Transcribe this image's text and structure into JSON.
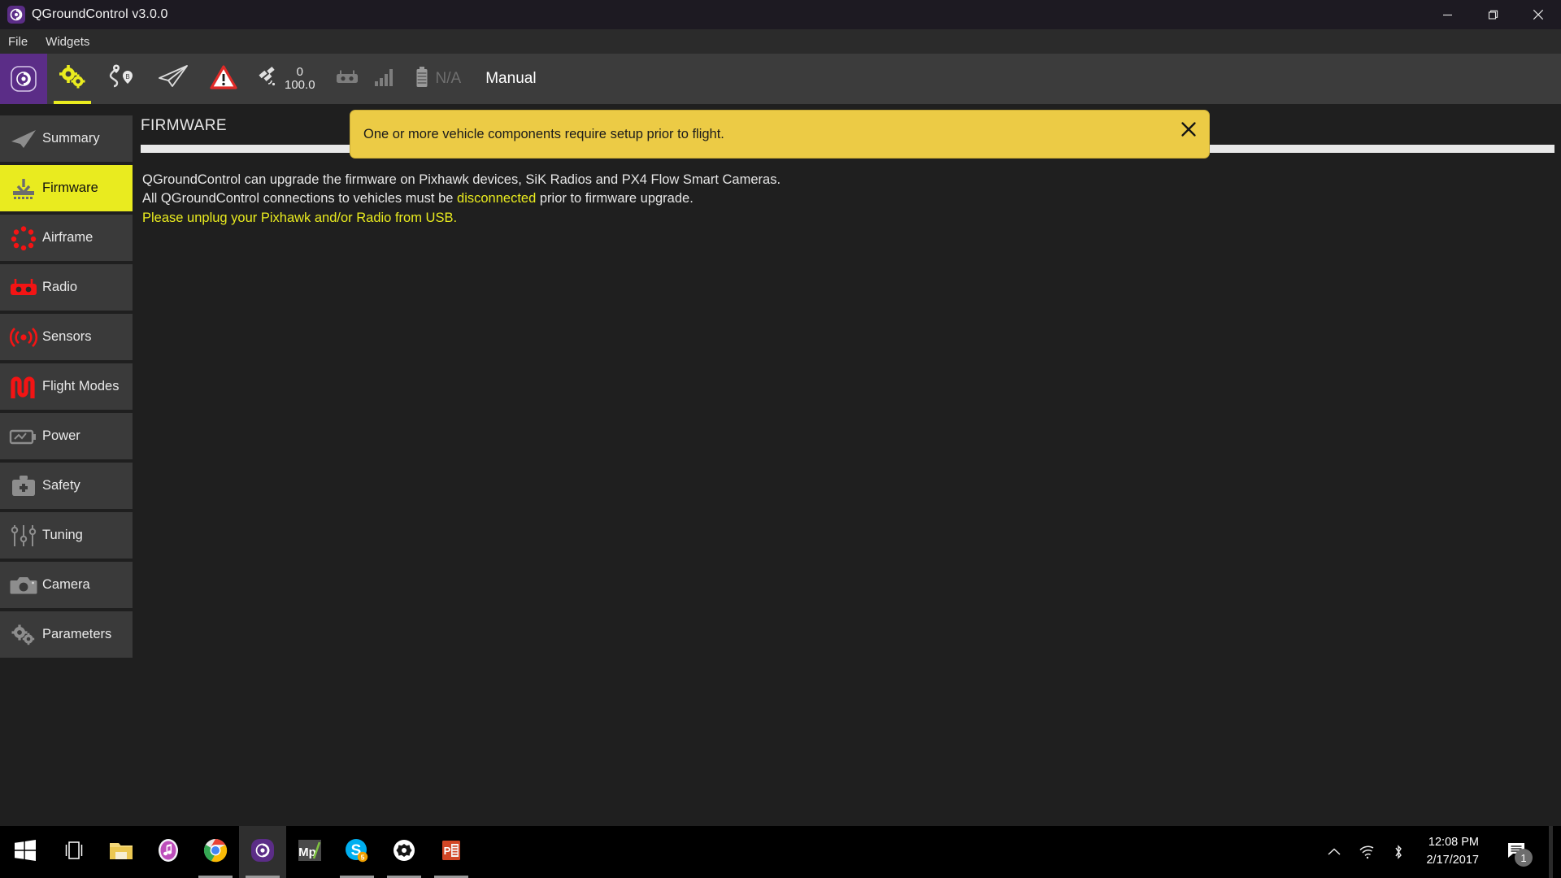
{
  "window": {
    "title": "QGroundControl v3.0.0",
    "app_icon": "qgroundcontrol-logo-icon",
    "minimize_label": "Minimize",
    "restore_label": "Restore",
    "close_label": "Close"
  },
  "menubar": {
    "items": [
      {
        "label": "File",
        "name": "menu-file"
      },
      {
        "label": "Widgets",
        "name": "menu-widgets"
      }
    ]
  },
  "toolbar": {
    "logo_icon": "qgroundcontrol-logo-icon",
    "buttons": [
      {
        "name": "toolbar-settings",
        "icon": "gears-icon",
        "active": true
      },
      {
        "name": "toolbar-plan",
        "icon": "waypoints-icon",
        "active": false
      },
      {
        "name": "toolbar-fly",
        "icon": "paper-plane-icon",
        "active": false
      },
      {
        "name": "toolbar-warning",
        "icon": "warning-triangle-icon",
        "active": false
      }
    ],
    "satellite": {
      "icon": "satellite-icon",
      "count": "0",
      "hdop": "100.0"
    },
    "rc": {
      "icon": "rc-transmitter-icon"
    },
    "signal": {
      "icon": "signal-bars-icon"
    },
    "battery": {
      "icon": "battery-icon",
      "value": "N/A"
    },
    "flight_mode": "Manual"
  },
  "sidebar": {
    "items": [
      {
        "label": "Summary",
        "name": "sidebar-item-summary",
        "icon": "paper-plane-icon",
        "selected": false
      },
      {
        "label": "Firmware",
        "name": "sidebar-item-firmware",
        "icon": "download-icon",
        "selected": true
      },
      {
        "label": "Airframe",
        "name": "sidebar-item-airframe",
        "icon": "airframe-icon",
        "selected": false
      },
      {
        "label": "Radio",
        "name": "sidebar-item-radio",
        "icon": "rc-transmitter-icon",
        "selected": false
      },
      {
        "label": "Sensors",
        "name": "sidebar-item-sensors",
        "icon": "sensors-icon",
        "selected": false
      },
      {
        "label": "Flight Modes",
        "name": "sidebar-item-flight-modes",
        "icon": "flight-modes-icon",
        "selected": false
      },
      {
        "label": "Power",
        "name": "sidebar-item-power",
        "icon": "power-icon",
        "selected": false
      },
      {
        "label": "Safety",
        "name": "sidebar-item-safety",
        "icon": "safety-kit-icon",
        "selected": false
      },
      {
        "label": "Tuning",
        "name": "sidebar-item-tuning",
        "icon": "sliders-icon",
        "selected": false
      },
      {
        "label": "Camera",
        "name": "sidebar-item-camera",
        "icon": "camera-icon",
        "selected": false
      },
      {
        "label": "Parameters",
        "name": "sidebar-item-parameters",
        "icon": "gears-icon",
        "selected": false
      }
    ]
  },
  "main": {
    "page_title": "FIRMWARE",
    "line1": "QGroundControl can upgrade the firmware on Pixhawk devices, SiK Radios and PX4 Flow Smart Cameras.",
    "line2_pre": "All QGroundControl connections to vehicles must be ",
    "line2_hl": "disconnected",
    "line2_post": " prior to firmware upgrade.",
    "line3": "Please unplug your Pixhawk and/or Radio from USB."
  },
  "banner": {
    "text": "One or more vehicle components require setup prior to flight.",
    "close_icon": "close-icon",
    "background": "#eccb45"
  },
  "taskbar": {
    "start": {
      "name": "start-button",
      "icon": "windows-logo-icon"
    },
    "task_view": {
      "name": "task-view-button",
      "icon": "task-view-icon"
    },
    "apps": [
      {
        "name": "taskbar-file-explorer",
        "icon": "folder-icon",
        "running": false,
        "active": false
      },
      {
        "name": "taskbar-itunes",
        "icon": "itunes-icon",
        "running": false,
        "active": false
      },
      {
        "name": "taskbar-chrome",
        "icon": "chrome-icon",
        "running": true,
        "active": false
      },
      {
        "name": "taskbar-qgroundcontrol",
        "icon": "qgroundcontrol-logo-icon",
        "running": true,
        "active": true
      },
      {
        "name": "taskbar-mission-planner",
        "icon": "mission-planner-icon",
        "running": false,
        "active": false
      },
      {
        "name": "taskbar-skype",
        "icon": "skype-icon",
        "running": true,
        "active": false,
        "badge": "5"
      },
      {
        "name": "taskbar-app-white",
        "icon": "gear-badge-icon",
        "running": true,
        "active": false
      },
      {
        "name": "taskbar-powerpoint",
        "icon": "powerpoint-icon",
        "running": true,
        "active": false
      }
    ],
    "tray": {
      "chevron": "chevron-up-icon",
      "wifi": "wifi-icon",
      "bluetooth": "bluetooth-icon",
      "time": "12:08 PM",
      "date": "2/17/2017",
      "notifications_icon": "notification-icon",
      "notifications_count": "1"
    }
  }
}
